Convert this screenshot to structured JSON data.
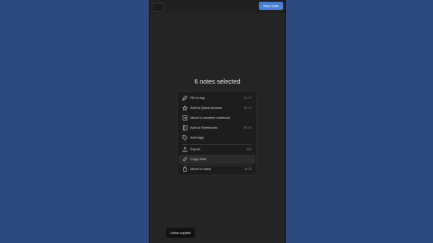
{
  "header": {
    "new_note_label": "New Note"
  },
  "main": {
    "selection_title": "6 notes selected"
  },
  "menu": {
    "items": [
      {
        "label": "Pin to top",
        "shortcut": "⌘⇧P",
        "icon": "pin-icon"
      },
      {
        "label": "Add to Quick Access",
        "shortcut": "⌘⇧S",
        "icon": "star-icon"
      },
      {
        "label": "Move to another notebook",
        "shortcut": "",
        "icon": "notebook-move-icon"
      },
      {
        "label": "Add to Notebooks",
        "shortcut": "⌘⇧M",
        "icon": "notebook-icon"
      },
      {
        "label": "Add tags",
        "shortcut": "",
        "icon": "tag-icon"
      },
      {
        "label": "Export",
        "shortcut": "⌘E",
        "icon": "export-icon"
      },
      {
        "label": "Copy links",
        "shortcut": "",
        "icon": "link-icon"
      },
      {
        "label": "Move to trash",
        "shortcut": "⌘⌫",
        "icon": "trash-icon"
      }
    ]
  },
  "toast": {
    "message": "Links copied"
  },
  "colors": {
    "accent": "#4a7fd8",
    "background": "#2c4a7e",
    "app_bg": "#242424"
  }
}
